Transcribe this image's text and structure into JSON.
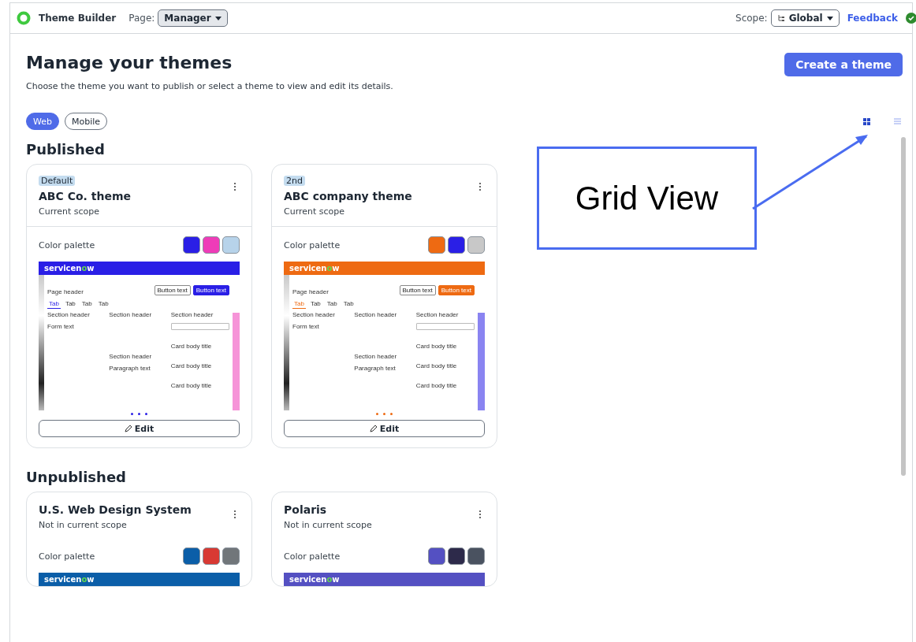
{
  "topbar": {
    "app_name": "Theme Builder",
    "page_label": "Page:",
    "page_value": "Manager",
    "scope_label": "Scope:",
    "scope_value": "Global",
    "feedback": "Feedback"
  },
  "header": {
    "title": "Manage your themes",
    "subtitle": "Choose the theme you want to publish or select a theme to view and edit its details.",
    "create_button": "Create a theme"
  },
  "platform_tabs": [
    {
      "label": "Web",
      "selected": true
    },
    {
      "label": "Mobile",
      "selected": false
    }
  ],
  "view_toggle": [
    {
      "kind": "grid",
      "selected": true
    },
    {
      "kind": "list",
      "selected": false
    }
  ],
  "sections": [
    {
      "title": "Published",
      "cards": [
        {
          "badge": "Default",
          "name": "ABC Co. theme",
          "scope": "Current scope",
          "palette_label": "Color palette",
          "swatches": [
            {
              "color": "#2a1fe6"
            },
            {
              "color": "#ee3cb8"
            },
            {
              "color": "#b7d3ea"
            }
          ],
          "brand": {
            "before": "servicen",
            "accent": "o",
            "after": "w"
          },
          "preview": {
            "page_header": "Page header",
            "buttons": [
              "Button text",
              "Button text"
            ],
            "tabs": [
              {
                "label": "Tab",
                "selected": true
              },
              {
                "label": "Tab",
                "selected": false
              },
              {
                "label": "Tab",
                "selected": false
              },
              {
                "label": "Tab",
                "selected": false
              }
            ],
            "columns": [
              {
                "items": [
                  {
                    "kind": "header",
                    "text": "Section header"
                  },
                  {
                    "kind": "text",
                    "text": "Form text"
                  }
                ]
              },
              {
                "items": [
                  {
                    "kind": "header",
                    "text": "Section header"
                  },
                  {
                    "kind": "header",
                    "text": "Section header"
                  },
                  {
                    "kind": "text",
                    "text": "Paragraph text"
                  }
                ]
              },
              {
                "items": [
                  {
                    "kind": "header",
                    "text": "Section header"
                  },
                  {
                    "kind": "input"
                  },
                  {
                    "kind": "card",
                    "text": "Card body title"
                  },
                  {
                    "kind": "card",
                    "text": "Card body title"
                  },
                  {
                    "kind": "card",
                    "text": "Card body title"
                  }
                ]
              }
            ]
          },
          "edit": "Edit"
        },
        {
          "badge": "2nd",
          "name": "ABC company theme",
          "scope": "Current scope",
          "palette_label": "Color palette",
          "swatches": [
            {
              "color": "#ee6a12"
            },
            {
              "color": "#2a1fe6"
            },
            {
              "color": "#c8c8c8"
            }
          ],
          "brand": {
            "before": "servicen",
            "accent": "o",
            "after": "w"
          },
          "preview": {
            "page_header": "Page header",
            "buttons": [
              "Button text",
              "Button text"
            ],
            "tabs": [
              {
                "label": "Tab",
                "selected": true
              },
              {
                "label": "Tab",
                "selected": false
              },
              {
                "label": "Tab",
                "selected": false
              },
              {
                "label": "Tab",
                "selected": false
              }
            ],
            "columns": [
              {
                "items": [
                  {
                    "kind": "header",
                    "text": "Section header"
                  },
                  {
                    "kind": "text",
                    "text": "Form text"
                  }
                ]
              },
              {
                "items": [
                  {
                    "kind": "header",
                    "text": "Section header"
                  },
                  {
                    "kind": "header",
                    "text": "Section header"
                  },
                  {
                    "kind": "text",
                    "text": "Paragraph text"
                  }
                ]
              },
              {
                "items": [
                  {
                    "kind": "header",
                    "text": "Section header"
                  },
                  {
                    "kind": "input"
                  },
                  {
                    "kind": "card",
                    "text": "Card body title"
                  },
                  {
                    "kind": "card",
                    "text": "Card body title"
                  },
                  {
                    "kind": "card",
                    "text": "Card body title"
                  }
                ]
              }
            ]
          },
          "edit": "Edit"
        }
      ]
    },
    {
      "title": "Unpublished",
      "cards": [
        {
          "name": "U.S. Web Design System",
          "scope": "Not in current scope",
          "palette_label": "Color palette",
          "swatches": [
            {
              "color": "#0b5ea8"
            },
            {
              "color": "#d83933"
            },
            {
              "color": "#71767a"
            }
          ],
          "brand": {
            "before": "servicen",
            "accent": "o",
            "after": "w"
          }
        },
        {
          "name": "Polaris",
          "scope": "Not in current scope",
          "palette_label": "Color palette",
          "swatches": [
            {
              "color": "#5450c2"
            },
            {
              "color": "#2d2a4a"
            },
            {
              "color": "#4a5260"
            }
          ],
          "brand": {
            "before": "servicen",
            "accent": "o",
            "after": "w"
          }
        }
      ]
    }
  ],
  "annotation": {
    "text": "Grid View"
  }
}
